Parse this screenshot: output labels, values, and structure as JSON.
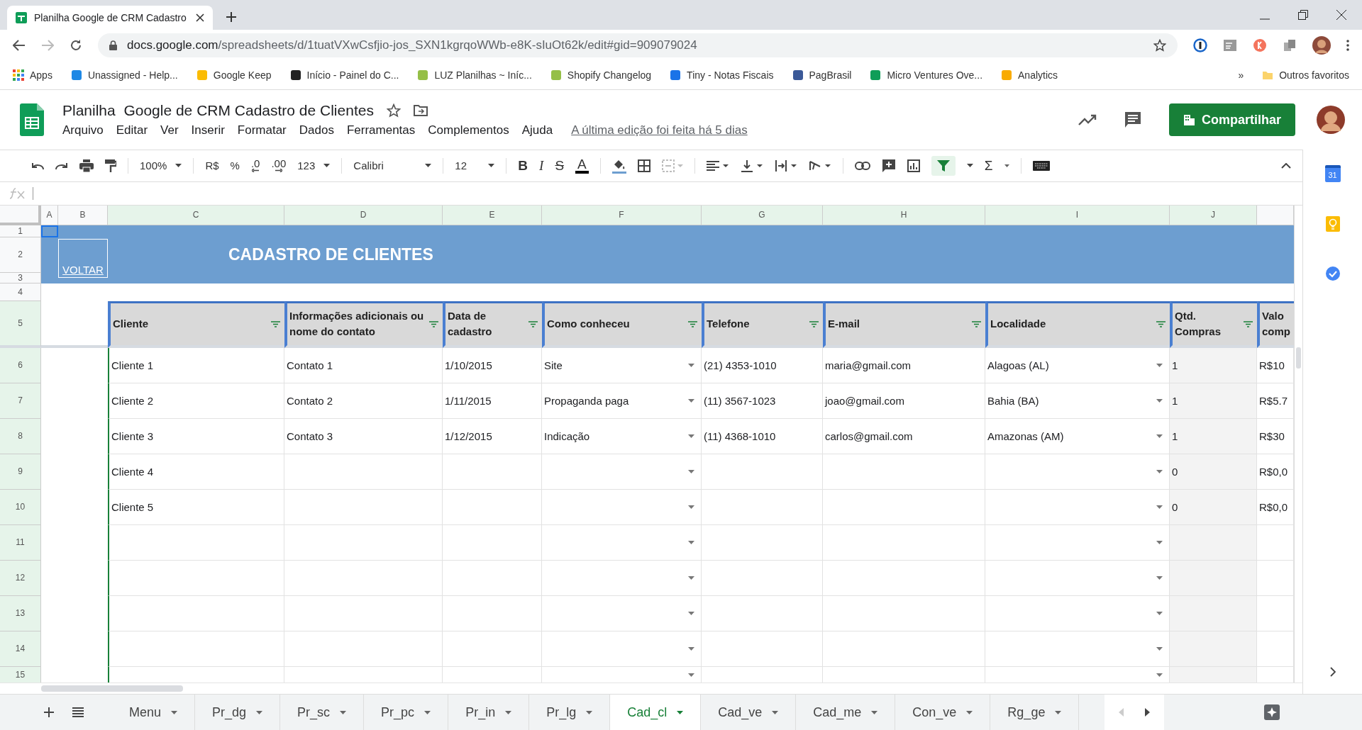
{
  "browser": {
    "tab_title": "Planilha Google de CRM Cadastro",
    "url_host": "docs.google.com",
    "url_path": "/spreadsheets/d/1tuatVXwCsfjio-jos_SXN1kgrqoWWb-e8K-sIuOt62k/edit#gid=909079024",
    "bookmarks": [
      "Apps",
      "Unassigned - Help...",
      "Google Keep",
      "Início - Painel do C...",
      "LUZ Planilhas ~ Iníc...",
      "Shopify Changelog",
      "Tiny - Notas Fiscais",
      "PagBrasil",
      "Micro Ventures Ove...",
      "Analytics"
    ],
    "more_bookmarks": "»",
    "other_bookmarks": "Outros favoritos"
  },
  "document": {
    "title": "Planilha  Google de CRM Cadastro de Clientes",
    "menus": [
      "Arquivo",
      "Editar",
      "Ver",
      "Inserir",
      "Formatar",
      "Dados",
      "Ferramentas",
      "Complementos",
      "Ajuda"
    ],
    "last_edit": "A última edição foi feita há 5 dias",
    "share_button": "Compartilhar"
  },
  "toolbar": {
    "zoom": "100%",
    "currency": "R$",
    "percent": "%",
    "decimal_less": ".0",
    "decimal_more": ".00",
    "number_format": "123",
    "font": "Calibri",
    "font_size": "12",
    "bold": "B",
    "italic": "I",
    "strike": "S",
    "text_color": "A",
    "sum": "Σ",
    "filter_on": true,
    "merge_disabled": true
  },
  "side_panel": {
    "calendar_day": "31"
  },
  "sheet": {
    "column_letters": [
      "A",
      "B",
      "C",
      "D",
      "E",
      "F",
      "G",
      "H",
      "I",
      "J"
    ],
    "row_numbers": [
      "1",
      "2",
      "3",
      "4",
      "5",
      "6",
      "7",
      "8",
      "9",
      "10",
      "11",
      "12",
      "13",
      "14",
      "15"
    ],
    "banner": {
      "link": "VOLTAR",
      "title": "CADASTRO DE CLIENTES"
    }
  },
  "table": {
    "columns": [
      {
        "label": "Cliente",
        "filter": true,
        "dropdown": false
      },
      {
        "label": "Informações adicionais ou nome do contato",
        "filter": true,
        "dropdown": false
      },
      {
        "label": "Data de cadastro",
        "filter": true,
        "dropdown": false
      },
      {
        "label": "Como conheceu",
        "filter": true,
        "dropdown": true
      },
      {
        "label": "Telefone",
        "filter": true,
        "dropdown": false
      },
      {
        "label": "E-mail",
        "filter": true,
        "dropdown": false
      },
      {
        "label": "Localidade",
        "filter": true,
        "dropdown": true
      },
      {
        "label": "Qtd. Compras",
        "filter": true,
        "dropdown": false
      },
      {
        "label": "Valo comp",
        "dropdown": false
      }
    ],
    "rows": [
      {
        "cells": [
          "Cliente 1",
          "Contato 1",
          "1/10/2015",
          "Site",
          "(21) 4353-1010",
          "maria@gmail.com",
          "Alagoas (AL)",
          "1",
          "R$10"
        ]
      },
      {
        "cells": [
          "Cliente 2",
          "Contato 2",
          "1/11/2015",
          "Propaganda paga",
          "(11) 3567-1023",
          "joao@gmail.com",
          "Bahia (BA)",
          "1",
          "R$5.7"
        ]
      },
      {
        "cells": [
          "Cliente 3",
          "Contato 3",
          "1/12/2015",
          "Indicação",
          "(11) 4368-1010",
          "carlos@gmail.com",
          "Amazonas (AM)",
          "1",
          "R$30"
        ]
      },
      {
        "cells": [
          "Cliente 4",
          null,
          null,
          null,
          null,
          null,
          null,
          "0",
          "R$0,0"
        ]
      },
      {
        "cells": [
          "Cliente 5",
          null,
          null,
          null,
          null,
          null,
          null,
          "0",
          "R$0,0"
        ]
      }
    ]
  },
  "sheet_tabs": [
    {
      "label": "Menu",
      "selected": false
    },
    {
      "label": "Pr_dg",
      "selected": false
    },
    {
      "label": "Pr_sc",
      "selected": false
    },
    {
      "label": "Pr_pc",
      "selected": false
    },
    {
      "label": "Pr_in",
      "selected": false
    },
    {
      "label": "Pr_lg",
      "selected": false
    },
    {
      "label": "Cad_cl",
      "selected": true
    },
    {
      "label": "Cad_ve",
      "selected": false
    },
    {
      "label": "Cad_me",
      "selected": false
    },
    {
      "label": "Con_ve",
      "selected": false
    },
    {
      "label": "Rg_ge",
      "selected": false
    }
  ]
}
